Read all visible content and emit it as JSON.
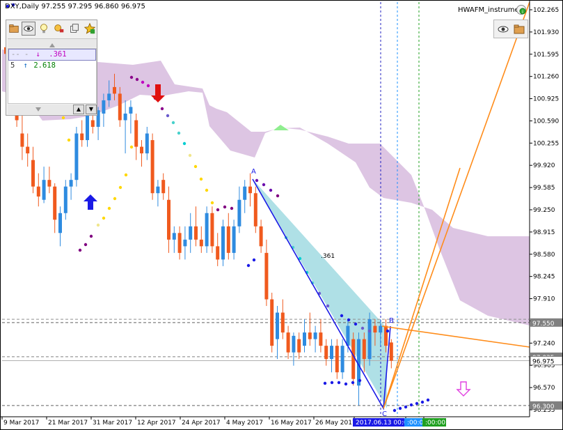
{
  "window": {
    "title": "DXY,Daily  97.255 97.295 96.860 96.975",
    "instrument_label": "HWAFM_instrument"
  },
  "levels_panel": {
    "rows": [
      {
        "style": "dashed",
        "arrow": "↓",
        "value": ".361",
        "color": "#c000c0"
      },
      {
        "style": "solid",
        "prefix": "5",
        "arrow": "↑",
        "value": "2.618",
        "color": "#008000"
      }
    ],
    "selected_index": 0
  },
  "icons": {
    "toolbar": [
      "folder-icon",
      "eye-icon",
      "bulb-icon",
      "tools-icon",
      "copy-icon",
      "star-icon"
    ],
    "mini_toolbar": [
      "eye-icon",
      "folder-icon"
    ],
    "buy_arrow": "up-arrow",
    "sell_arrow": "down-arrow",
    "forecast_arrow": "down-outline-arrow"
  },
  "colors": {
    "bull_candle": "#2e8be0",
    "bear_candle": "#f05a1e",
    "cloud": "#d9bfe0",
    "cloud_green": "#90ee90",
    "zigzag": "#1a1ae6",
    "channel": "#a6dde3",
    "fibo_line": "#ff8c1a",
    "price_label_bg": "#808080"
  },
  "chart_data": {
    "type": "candlestick",
    "symbol": "DXY",
    "timeframe": "Daily",
    "ohlc_header": {
      "open": 97.255,
      "high": 97.295,
      "low": 96.86,
      "close": 96.975
    },
    "y_axis": {
      "ticks": [
        102.265,
        101.93,
        101.595,
        101.26,
        100.925,
        100.59,
        100.255,
        99.92,
        99.585,
        99.25,
        98.915,
        98.58,
        98.245,
        97.91,
        97.575,
        97.24,
        96.905,
        96.57,
        96.235
      ],
      "range": [
        96.235,
        102.265
      ],
      "price_labels": [
        {
          "value": "97.550",
          "highlight": false
        },
        {
          "value": "97.035",
          "highlight": false
        },
        {
          "value": "96.975",
          "highlight": true
        },
        {
          "value": "96.300",
          "highlight": false
        }
      ]
    },
    "x_axis": {
      "labels": [
        "9 Mar 2017",
        "21 Mar 2017",
        "31 Mar 2017",
        "12 Apr 2017",
        "24 Apr 2017",
        "4 May 2017",
        "16 May 2017",
        "26 May 2017",
        "2017.06.13 00:00",
        ":00:00",
        ":00:00"
      ]
    },
    "pattern_points": [
      "A",
      "B",
      "C"
    ],
    "fibo_label": ".361",
    "candles": [
      [
        101.7,
        101.9,
        101.4,
        101.6
      ],
      [
        101.5,
        101.6,
        100.7,
        100.9
      ],
      [
        100.9,
        101.0,
        100.5,
        100.6
      ],
      [
        100.4,
        100.7,
        100.0,
        100.2
      ],
      [
        100.2,
        100.4,
        99.9,
        100.1
      ],
      [
        100.0,
        100.2,
        99.5,
        99.6
      ],
      [
        99.6,
        99.8,
        99.3,
        99.45
      ],
      [
        99.4,
        99.9,
        99.35,
        99.7
      ],
      [
        99.7,
        99.9,
        99.5,
        99.6
      ],
      [
        99.6,
        99.65,
        98.9,
        99.1
      ],
      [
        98.9,
        99.3,
        98.7,
        99.2
      ],
      [
        99.2,
        99.7,
        99.1,
        99.6
      ],
      [
        99.6,
        99.8,
        99.4,
        99.7
      ],
      [
        99.7,
        100.5,
        99.6,
        100.4
      ],
      [
        100.4,
        100.6,
        100.2,
        100.3
      ],
      [
        100.3,
        100.8,
        100.2,
        100.7
      ],
      [
        100.6,
        100.9,
        100.4,
        100.5
      ],
      [
        100.5,
        100.8,
        100.3,
        100.75
      ],
      [
        100.7,
        101.0,
        100.5,
        100.9
      ],
      [
        100.9,
        101.2,
        100.8,
        101.0
      ],
      [
        101.1,
        101.3,
        100.9,
        101.0
      ],
      [
        101.0,
        101.1,
        100.5,
        100.6
      ],
      [
        100.6,
        100.9,
        100.1,
        100.7
      ],
      [
        100.7,
        100.9,
        100.4,
        100.8
      ],
      [
        100.6,
        100.7,
        100.0,
        100.2
      ],
      [
        100.2,
        100.3,
        99.9,
        100.1
      ],
      [
        100.1,
        100.5,
        100.0,
        100.4
      ],
      [
        100.3,
        100.4,
        99.4,
        99.5
      ],
      [
        99.5,
        99.7,
        99.3,
        99.6
      ],
      [
        99.7,
        99.8,
        99.4,
        99.5
      ],
      [
        99.4,
        99.6,
        98.6,
        98.8
      ],
      [
        98.8,
        99.0,
        98.6,
        98.9
      ],
      [
        98.9,
        99.0,
        98.5,
        98.6
      ],
      [
        98.7,
        99.0,
        98.5,
        98.8
      ],
      [
        98.8,
        99.2,
        98.6,
        99.0
      ],
      [
        99.0,
        99.3,
        98.7,
        98.8
      ],
      [
        98.8,
        99.0,
        98.6,
        98.7
      ],
      [
        98.7,
        99.3,
        98.6,
        99.2
      ],
      [
        99.2,
        99.3,
        98.6,
        98.7
      ],
      [
        98.7,
        98.9,
        98.4,
        98.5
      ],
      [
        98.5,
        99.1,
        98.4,
        99.0
      ],
      [
        99.0,
        99.2,
        98.5,
        98.6
      ],
      [
        98.6,
        99.1,
        98.5,
        99.0
      ],
      [
        99.0,
        99.6,
        98.9,
        99.4
      ],
      [
        99.4,
        99.7,
        99.2,
        99.6
      ],
      [
        99.6,
        99.8,
        99.3,
        99.5
      ],
      [
        99.5,
        99.6,
        98.9,
        99.0
      ],
      [
        99.0,
        99.1,
        98.6,
        98.7
      ],
      [
        98.6,
        98.8,
        97.8,
        97.9
      ],
      [
        97.9,
        98.0,
        97.1,
        97.2
      ],
      [
        97.3,
        97.8,
        97.0,
        97.7
      ],
      [
        97.7,
        97.9,
        97.3,
        97.4
      ],
      [
        97.4,
        97.5,
        97.0,
        97.1
      ],
      [
        97.1,
        97.4,
        96.9,
        97.35
      ],
      [
        97.3,
        97.4,
        97.0,
        97.1
      ],
      [
        97.2,
        97.6,
        97.1,
        97.4
      ],
      [
        97.4,
        97.7,
        97.2,
        97.3
      ],
      [
        97.3,
        97.5,
        97.1,
        97.4
      ],
      [
        97.4,
        97.6,
        97.1,
        97.2
      ],
      [
        97.2,
        97.3,
        96.9,
        97.0
      ],
      [
        97.0,
        97.3,
        96.8,
        97.2
      ],
      [
        97.2,
        97.3,
        96.7,
        96.8
      ],
      [
        96.8,
        97.3,
        96.7,
        97.2
      ],
      [
        97.2,
        97.6,
        97.1,
        97.5
      ],
      [
        97.3,
        97.4,
        96.6,
        96.7
      ],
      [
        96.6,
        97.4,
        96.3,
        97.3
      ],
      [
        97.3,
        97.4,
        96.8,
        97.0
      ],
      [
        97.0,
        97.7,
        96.9,
        97.6
      ],
      [
        97.5,
        97.6,
        97.2,
        97.4
      ],
      [
        97.4,
        97.6,
        97.2,
        97.5
      ],
      [
        97.5,
        97.6,
        97.1,
        97.2
      ],
      [
        97.25,
        97.3,
        96.86,
        96.975
      ]
    ]
  }
}
